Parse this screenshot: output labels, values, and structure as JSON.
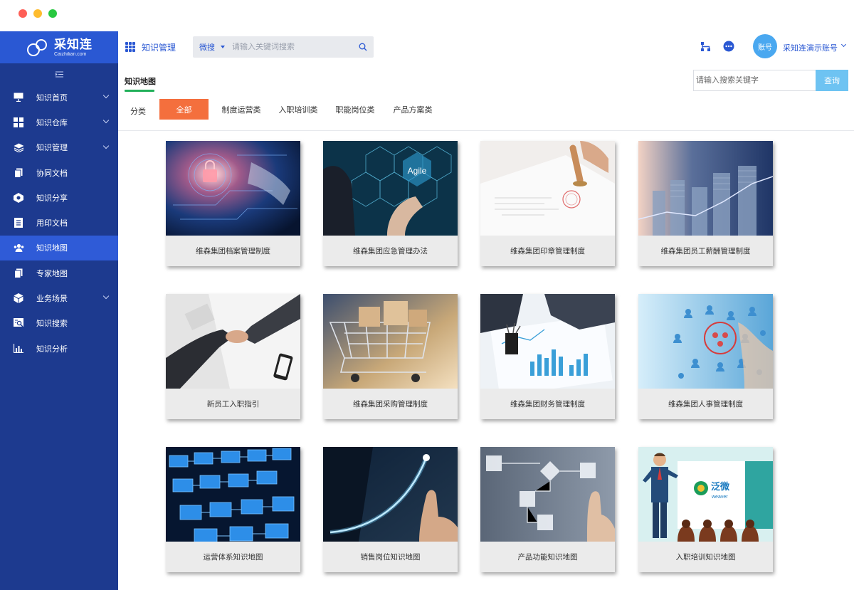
{
  "window": {
    "controls": [
      "close",
      "minimize",
      "maximize"
    ]
  },
  "sidebar": {
    "logo": {
      "title": "采知连",
      "subtitle": "Caizhilian.com"
    },
    "collapse_icon": "menu-fold-icon",
    "items": [
      {
        "label": "知识首页",
        "icon": "monitor-icon",
        "expandable": true,
        "active": false
      },
      {
        "label": "知识仓库",
        "icon": "grid-icon",
        "expandable": true,
        "active": false
      },
      {
        "label": "知识管理",
        "icon": "layers-icon",
        "expandable": true,
        "active": false
      },
      {
        "label": "协同文档",
        "icon": "documents-icon",
        "expandable": false,
        "active": false
      },
      {
        "label": "知识分享",
        "icon": "share-icon",
        "expandable": false,
        "active": false
      },
      {
        "label": "用印文档",
        "icon": "list-doc-icon",
        "expandable": false,
        "active": false
      },
      {
        "label": "知识地图",
        "icon": "users-map-icon",
        "expandable": false,
        "active": true
      },
      {
        "label": "专家地图",
        "icon": "documents-icon",
        "expandable": false,
        "active": false
      },
      {
        "label": "业务场景",
        "icon": "cube-icon",
        "expandable": true,
        "active": false
      },
      {
        "label": "知识搜索",
        "icon": "doc-search-icon",
        "expandable": false,
        "active": false
      },
      {
        "label": "知识分析",
        "icon": "bar-chart-icon",
        "expandable": false,
        "active": false
      }
    ]
  },
  "header": {
    "app_title": "知识管理",
    "search": {
      "scope": "微搜",
      "placeholder": "请输入关键词搜索"
    },
    "user": {
      "avatar_text": "账号",
      "name": "采知连演示账号"
    }
  },
  "section": {
    "tab": "知识地图",
    "keyword_placeholder": "请输入搜索关键字",
    "query_button": "查询",
    "colors": {
      "accent": "#21b05a",
      "active_filter": "#f46f3d",
      "sidebar": "#1d3a8f",
      "primary": "#2a58d3"
    }
  },
  "categories": {
    "label": "分类",
    "items": [
      "全部",
      "制度运营类",
      "入职培训类",
      "职能岗位类",
      "产品方案类"
    ],
    "active_index": 0
  },
  "cards": [
    {
      "title": "维森集团档案管理制度",
      "image": "cyber-lock"
    },
    {
      "title": "维森集团应急管理办法",
      "image": "agile-hexagons"
    },
    {
      "title": "维森集团印章管理制度",
      "image": "seal-stamp"
    },
    {
      "title": "维森集团员工薪酬管理制度",
      "image": "coin-stacks"
    },
    {
      "title": "新员工入职指引",
      "image": "handshake"
    },
    {
      "title": "维森集团采购管理制度",
      "image": "shopping-cart"
    },
    {
      "title": "维森集团财务管理制度",
      "image": "finance-charts"
    },
    {
      "title": "维森集团人事管理制度",
      "image": "people-network"
    },
    {
      "title": "运营体系知识地图",
      "image": "flowchart-blue"
    },
    {
      "title": "销售岗位知识地图",
      "image": "growth-curve"
    },
    {
      "title": "产品功能知识地图",
      "image": "flow-diagram"
    },
    {
      "title": "入职培训知识地图",
      "image": "training-presenter"
    }
  ],
  "card_images_text": {
    "agile": "Agile",
    "brand": "泛微",
    "brand_sub": "weaver"
  }
}
